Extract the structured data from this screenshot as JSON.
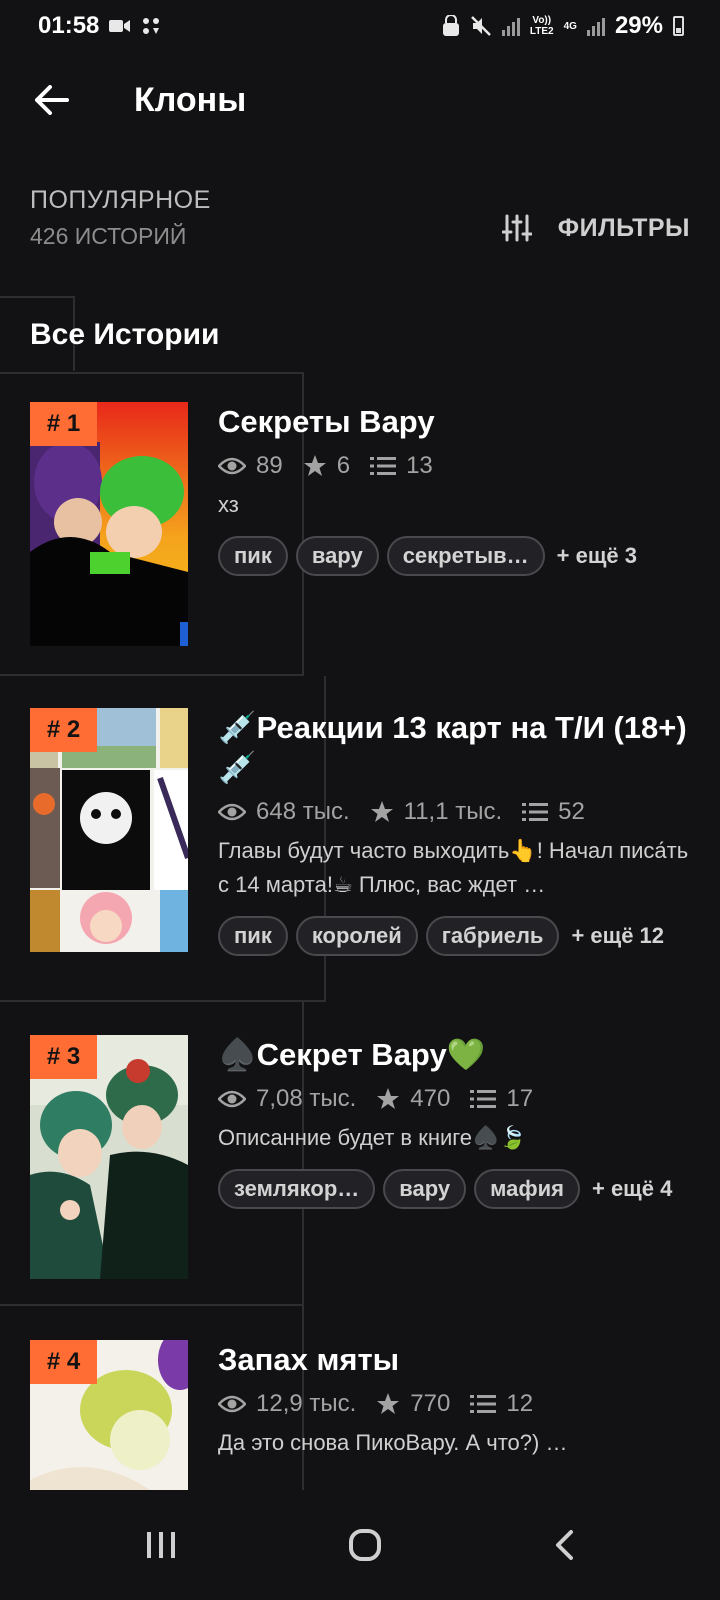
{
  "status_bar": {
    "time": "01:58",
    "net_top": "Vo))",
    "net_bottom": "LTE2",
    "net_type": "4G",
    "battery": "29%"
  },
  "app_bar": {
    "title": "Клоны"
  },
  "section": {
    "sort_title": "ПОПУЛЯРНОЕ",
    "count": "426 ИСТОРИЙ",
    "filters_label": "ФИЛЬТРЫ"
  },
  "list_heading": "Все Истории",
  "stories": [
    {
      "rank": "# 1",
      "title": "Секреты Вару",
      "views": "89",
      "votes": "6",
      "parts": "13",
      "description": "хз",
      "tags": [
        "пик",
        "вару",
        "секретыв…"
      ],
      "more": "+ ещё 3"
    },
    {
      "rank": "# 2",
      "title": "💉Реакции 13 карт на Т/И (18+)💉",
      "views": "648 тыс.",
      "votes": "11,1 тыс.",
      "parts": "52",
      "description": "Главы будут часто выходить👆! Начал писа́ть с 14 марта!☕ Плюс, вас ждет …",
      "tags": [
        "пик",
        "королей",
        "габриель"
      ],
      "more": "+ ещё 12"
    },
    {
      "rank": "# 3",
      "title": "♠️Секрет Вару💚",
      "views": "7,08 тыс.",
      "votes": "470",
      "parts": "17",
      "description": "Описанние будет в книге♠️🍃",
      "tags": [
        "землякор…",
        "вару",
        "мафия"
      ],
      "more": "+ ещё 4"
    },
    {
      "rank": "# 4",
      "title": "Запах мяты",
      "views": "12,9 тыс.",
      "votes": "770",
      "parts": "12",
      "description": "Да это снова ПикоВару. А что?) …",
      "tags": [],
      "more": ""
    }
  ],
  "colors": {
    "background": "#121214",
    "accent": "#ff6d35"
  }
}
